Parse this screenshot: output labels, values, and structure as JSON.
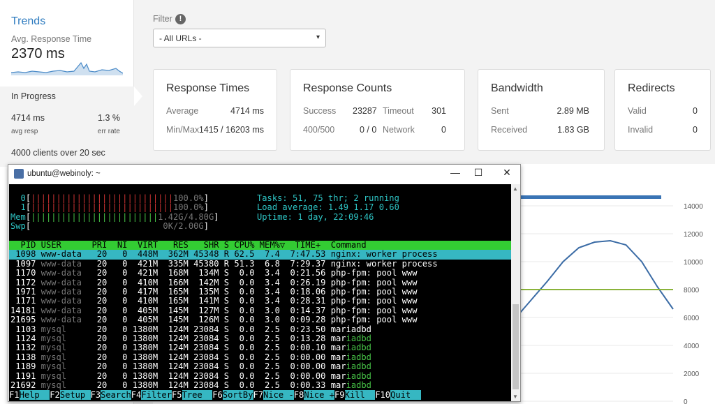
{
  "sidebar": {
    "trends_title": "Trends",
    "avg_label": "Avg. Response Time",
    "avg_value": "2370 ms",
    "in_progress": "In Progress",
    "avg_resp_value": "4714 ms",
    "avg_resp_label": "avg resp",
    "err_rate_value": "1.3 %",
    "err_rate_label": "err rate",
    "clients_text": "4000 clients over 20 sec"
  },
  "filter": {
    "label": "Filter",
    "info_icon": "!",
    "selected": "- All URLs -"
  },
  "cards": {
    "response_times": {
      "title": "Response Times",
      "avg_label": "Average",
      "avg_value": "4714 ms",
      "minmax_label": "Min/Max",
      "minmax_value": "1415 / 16203 ms"
    },
    "response_counts": {
      "title": "Response Counts",
      "success_label": "Success",
      "success_value": "23287",
      "timeout_label": "Timeout",
      "timeout_value": "301",
      "r400_label": "400/500",
      "r400_value": "0 / 0",
      "network_label": "Network",
      "network_value": "0"
    },
    "bandwidth": {
      "title": "Bandwidth",
      "sent_label": "Sent",
      "sent_value": "2.89 MB",
      "received_label": "Received",
      "received_value": "1.83 GB"
    },
    "redirects": {
      "title": "Redirects",
      "valid_label": "Valid",
      "valid_value": "0",
      "invalid_label": "Invalid",
      "invalid_value": "0"
    }
  },
  "chart_data": {
    "type": "line",
    "yticks": [
      "14000",
      "12000",
      "10000",
      "8000",
      "6000",
      "4000",
      "2000",
      "0"
    ],
    "ylim": [
      0,
      14000
    ],
    "series": [
      {
        "values": [
          6000,
          7300,
          8600,
          10000,
          11000,
          11400,
          11500,
          11200,
          10000,
          8200,
          6600
        ]
      },
      {
        "values": [
          8000,
          8000,
          8000,
          8000,
          8000,
          8000,
          8000,
          8000,
          8000,
          8000,
          8000
        ]
      }
    ],
    "colors": {
      "line1": "#3a6ba5",
      "line2": "#8ab33a",
      "bar": "#3a74b5"
    }
  },
  "window": {
    "title": "ubuntu@webinoly: ~",
    "minimize": "—",
    "maximize": "☐",
    "close": "✕"
  },
  "terminal": {
    "cpu0": "  0[||||||||||||||||||||||||||||100.0%]",
    "cpu1": "  1[||||||||||||||||||||||||||||100.0%]",
    "mem": "Mem[|||||||||||||||||||||||||1.42G/4.80G]",
    "swp": "Swp[                          0K/2.00G]",
    "tasks": "Tasks: 51, 75 thr; 2 running",
    "load": "Load average: 1.49 1.17 0.60",
    "uptime": "Uptime: 1 day, 22:09:46",
    "header": "  PID USER      PRI  NI  VIRT   RES   SHR S CPU% MEM%▽  TIME+  Command",
    "rows": [
      " 1098 www-data   20   0  448M  362M 45348 R 62.5  7.4  7:47.53 nginx: worker process",
      " 1097 www-data   20   0  421M  335M 45380 R 51.3  6.8  7:29.37 nginx: worker process",
      " 1170 www-data   20   0  421M  168M  134M S  0.0  3.4  0:21.56 php-fpm: pool www",
      " 1172 www-data   20   0  410M  166M  142M S  0.0  3.4  0:26.19 php-fpm: pool www",
      " 1971 www-data   20   0  417M  165M  135M S  0.0  3.4  0:18.06 php-fpm: pool www",
      " 1171 www-data   20   0  410M  165M  141M S  0.0  3.4  0:28.31 php-fpm: pool www",
      "14181 www-data   20   0  405M  145M  127M S  0.0  3.0  0:14.37 php-fpm: pool www",
      "21695 www-data   20   0  405M  145M  126M S  0.0  3.0  0:09.28 php-fpm: pool www",
      " 1103 mysql      20   0 1380M  124M 23084 S  0.0  2.5  0:23.50 mariadbd",
      " 1124 mysql      20   0 1380M  124M 23084 S  0.0  2.5  0:13.28 mariadbd",
      " 1132 mysql      20   0 1380M  124M 23084 S  0.0  2.5  0:00.10 mariadbd",
      " 1138 mysql      20   0 1380M  124M 23084 S  0.0  2.5  0:00.00 mariadbd",
      " 1189 mysql      20   0 1380M  124M 23084 S  0.0  2.5  0:00.00 mariadbd",
      " 1191 mysql      20   0 1380M  124M 23084 S  0.0  2.5  0:00.00 mariadbd",
      "21692 mysql      20   0 1380M  124M 23084 S  0.0  2.5  0:00.33 mariadbd"
    ],
    "fkeys": [
      {
        "key": "F1",
        "label": "Help  "
      },
      {
        "key": "F2",
        "label": "Setup "
      },
      {
        "key": "F3",
        "label": "Search"
      },
      {
        "key": "F4",
        "label": "Filter"
      },
      {
        "key": "F5",
        "label": "Tree  "
      },
      {
        "key": "F6",
        "label": "SortBy"
      },
      {
        "key": "F7",
        "label": "Nice -"
      },
      {
        "key": "F8",
        "label": "Nice +"
      },
      {
        "key": "F9",
        "label": "Kill  "
      },
      {
        "key": "F10",
        "label": "Quit  "
      }
    ]
  }
}
